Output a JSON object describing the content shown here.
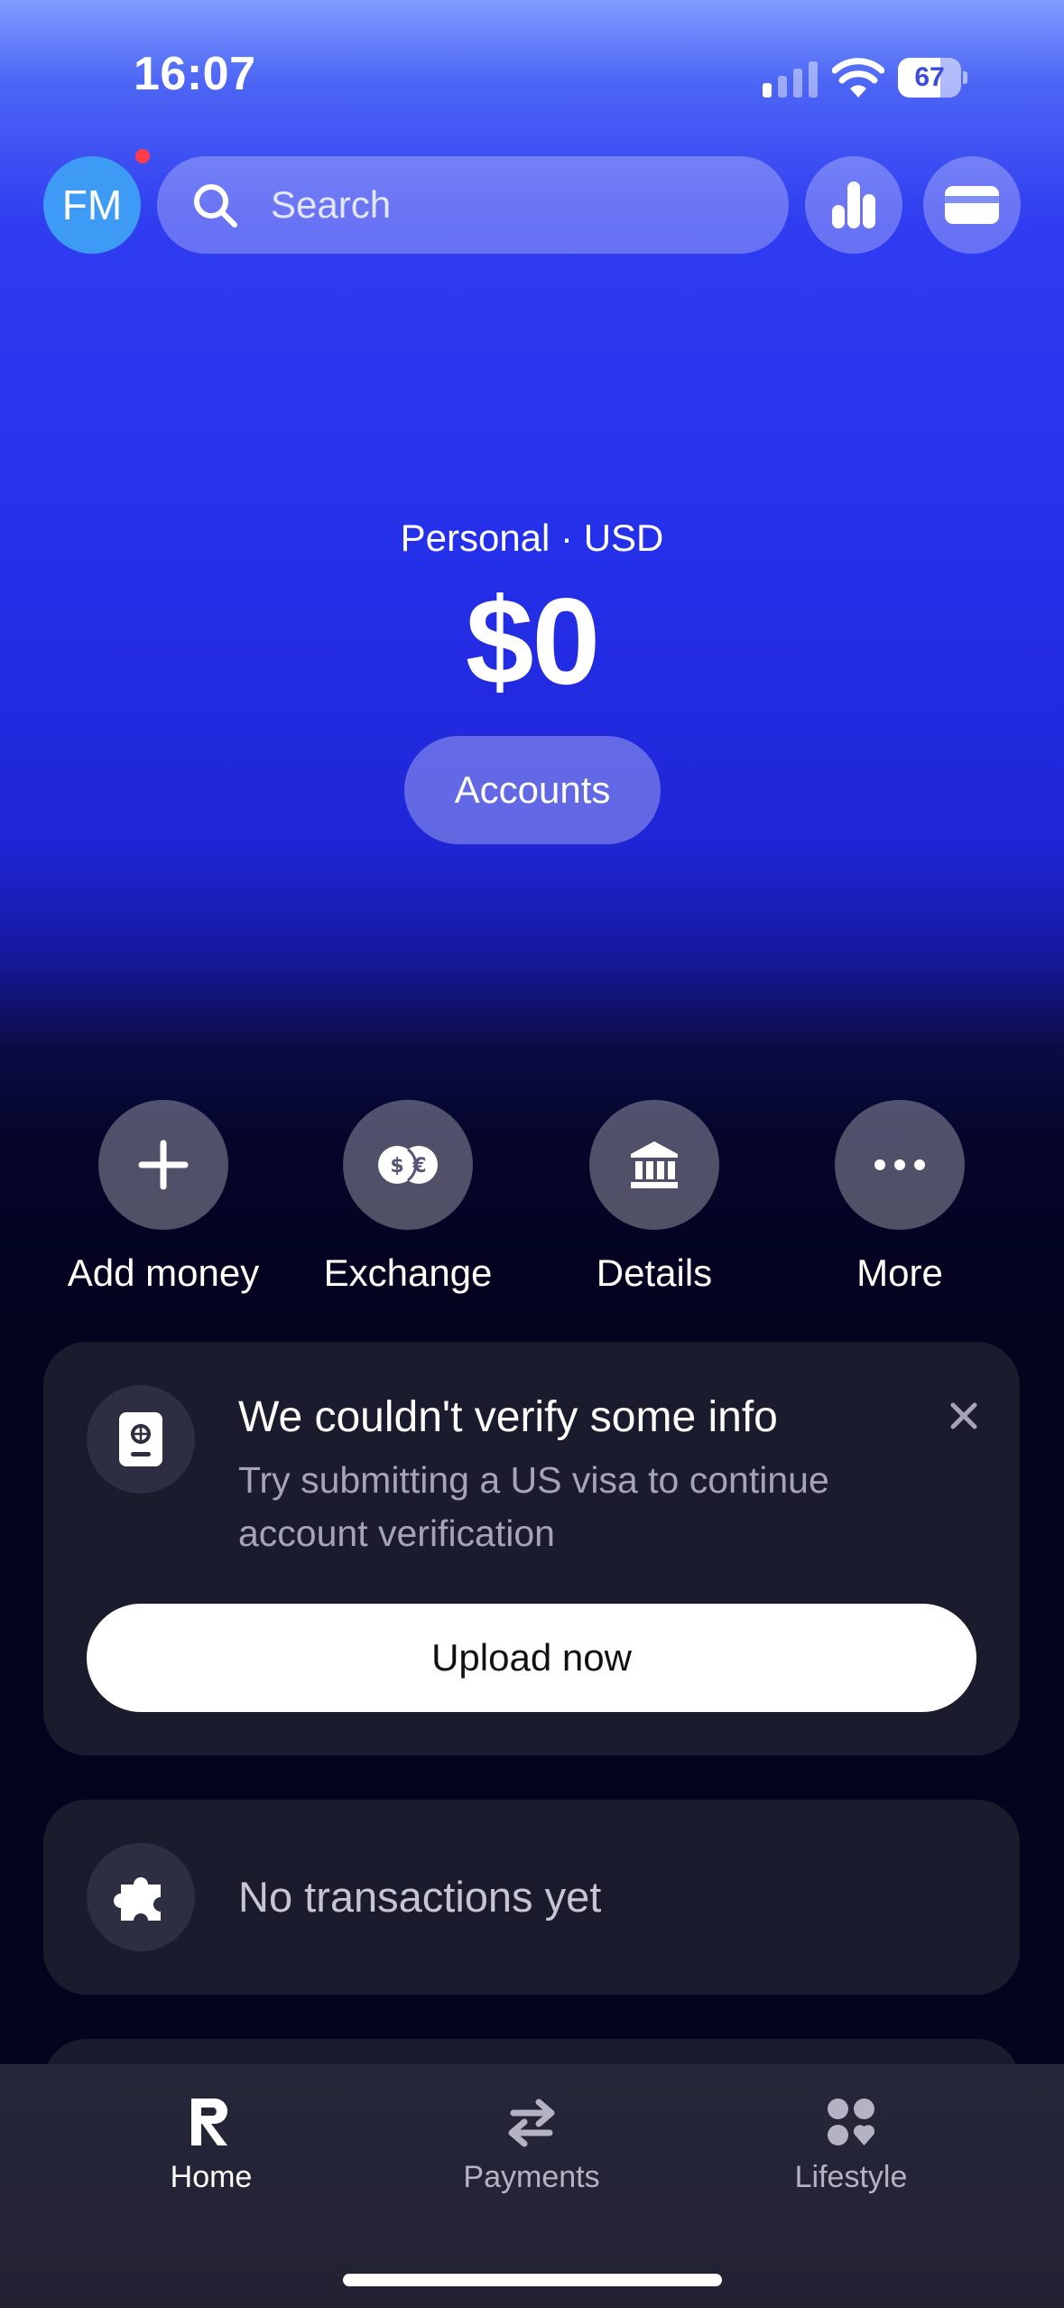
{
  "status_bar": {
    "time": "16:07",
    "battery_level": "67",
    "battery_fraction": 0.67
  },
  "header": {
    "avatar_initials": "FM",
    "search_placeholder": "Search"
  },
  "account": {
    "label": "Personal · USD",
    "balance": "$0",
    "accounts_button": "Accounts"
  },
  "actions": [
    {
      "label": "Add money",
      "icon": "plus-icon"
    },
    {
      "label": "Exchange",
      "icon": "currency-exchange-icon"
    },
    {
      "label": "Details",
      "icon": "bank-icon"
    },
    {
      "label": "More",
      "icon": "ellipsis-icon"
    }
  ],
  "verify_card": {
    "title": "We couldn't verify some info",
    "description": "Try submitting a US visa to continue account verification",
    "button": "Upload now",
    "icon": "passport-icon"
  },
  "transactions_card": {
    "empty_text": "No transactions yet",
    "icon": "puzzle-icon"
  },
  "bottom_nav": [
    {
      "label": "Home",
      "icon": "revolut-logo-icon",
      "active": true
    },
    {
      "label": "Payments",
      "icon": "transfer-arrows-icon",
      "active": false
    },
    {
      "label": "Lifestyle",
      "icon": "lifestyle-grid-icon",
      "active": false
    }
  ],
  "colors": {
    "accent_blue": "#2530ea",
    "avatar_blue": "#3d9bf5",
    "notification_red": "#ff3b4a",
    "card_background": "#1b1b2e",
    "app_background": "#04041f"
  }
}
